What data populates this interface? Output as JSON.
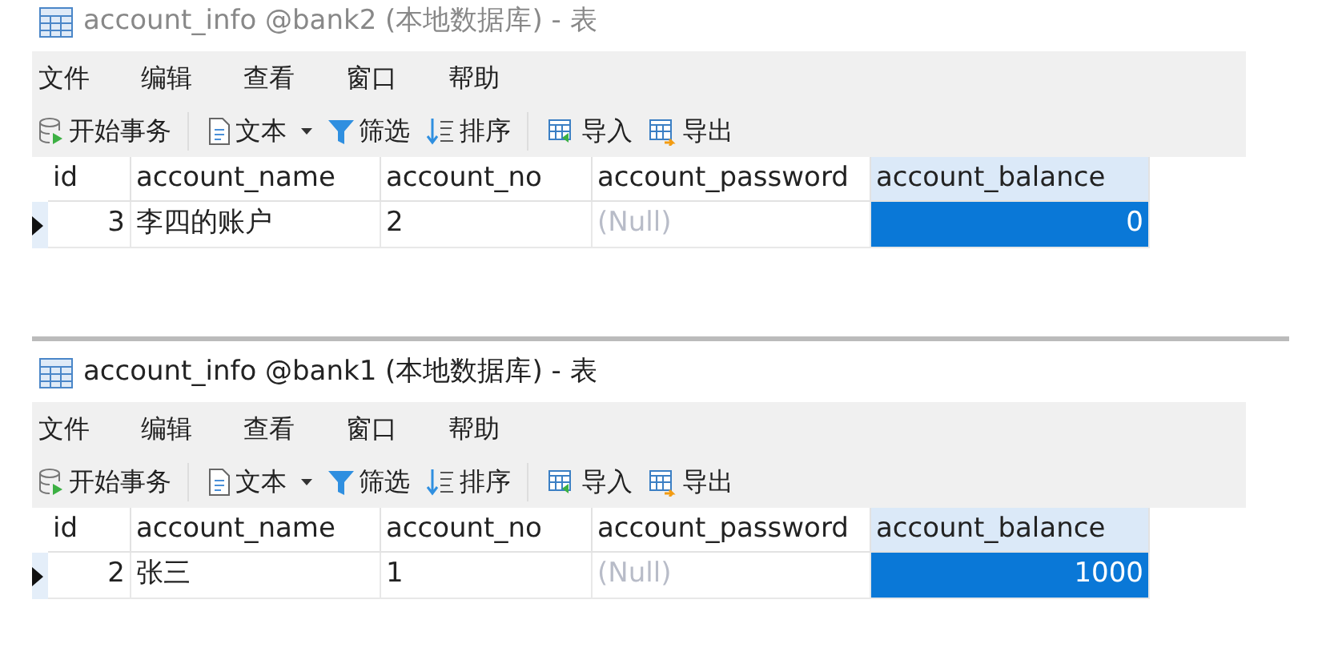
{
  "windows": [
    {
      "title": "account_info @bank2 (本地数据库) - 表",
      "active": false,
      "menu": [
        "文件",
        "编辑",
        "查看",
        "窗口",
        "帮助"
      ],
      "toolbar": [
        [
          {
            "kind": "transaction",
            "label": "开始事务",
            "dropdown": false
          }
        ],
        [
          {
            "kind": "text",
            "label": "文本",
            "dropdown": true
          },
          {
            "kind": "filter",
            "label": "筛选",
            "dropdown": false
          },
          {
            "kind": "sort",
            "label": "排序",
            "dropdown": false
          }
        ],
        [
          {
            "kind": "import",
            "label": "导入",
            "dropdown": false
          },
          {
            "kind": "export",
            "label": "导出",
            "dropdown": false
          }
        ]
      ],
      "columns": [
        {
          "label": "id",
          "kind": "number",
          "selected": false
        },
        {
          "label": "account_name",
          "kind": "text",
          "selected": false
        },
        {
          "label": "account_no",
          "kind": "text",
          "selected": false
        },
        {
          "label": "account_password",
          "kind": "text",
          "selected": false
        },
        {
          "label": "account_balance",
          "kind": "number",
          "selected": true
        }
      ],
      "rows": [
        {
          "current": true,
          "cells": [
            {
              "text": "3",
              "null": false,
              "selected": false
            },
            {
              "text": "李四的账户",
              "null": false,
              "selected": false
            },
            {
              "text": "2",
              "null": false,
              "selected": false
            },
            {
              "text": "(Null)",
              "null": true,
              "selected": false
            },
            {
              "text": "0",
              "null": false,
              "selected": true
            }
          ]
        }
      ]
    },
    {
      "title": "account_info @bank1 (本地数据库) - 表",
      "active": true,
      "menu": [
        "文件",
        "编辑",
        "查看",
        "窗口",
        "帮助"
      ],
      "toolbar": [
        [
          {
            "kind": "transaction",
            "label": "开始事务",
            "dropdown": false
          }
        ],
        [
          {
            "kind": "text",
            "label": "文本",
            "dropdown": true
          },
          {
            "kind": "filter",
            "label": "筛选",
            "dropdown": false
          },
          {
            "kind": "sort",
            "label": "排序",
            "dropdown": false
          }
        ],
        [
          {
            "kind": "import",
            "label": "导入",
            "dropdown": false
          },
          {
            "kind": "export",
            "label": "导出",
            "dropdown": false
          }
        ]
      ],
      "columns": [
        {
          "label": "id",
          "kind": "number",
          "selected": false
        },
        {
          "label": "account_name",
          "kind": "text",
          "selected": false
        },
        {
          "label": "account_no",
          "kind": "text",
          "selected": false
        },
        {
          "label": "account_password",
          "kind": "text",
          "selected": false
        },
        {
          "label": "account_balance",
          "kind": "number",
          "selected": true
        }
      ],
      "rows": [
        {
          "current": true,
          "cells": [
            {
              "text": "2",
              "null": false,
              "selected": false
            },
            {
              "text": "张三",
              "null": false,
              "selected": false
            },
            {
              "text": "1",
              "null": false,
              "selected": false
            },
            {
              "text": "(Null)",
              "null": true,
              "selected": false
            },
            {
              "text": "1000",
              "null": false,
              "selected": true
            }
          ]
        }
      ]
    }
  ]
}
